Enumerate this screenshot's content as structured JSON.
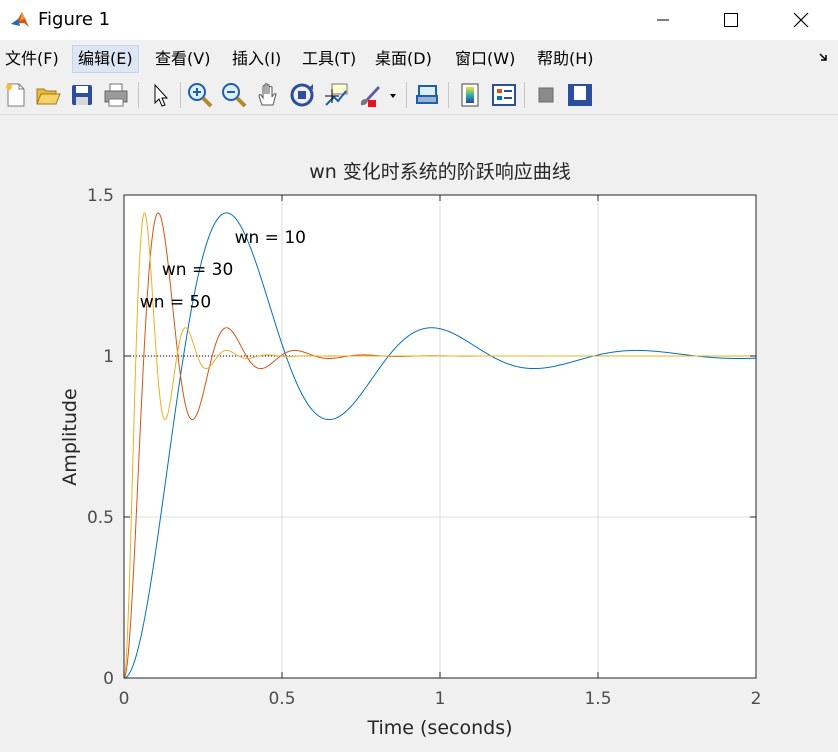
{
  "window": {
    "title": "Figure 1"
  },
  "menu": [
    {
      "label": "文件(F)",
      "active": false
    },
    {
      "label": "编辑(E)",
      "active": true
    },
    {
      "label": "查看(V)",
      "active": false
    },
    {
      "label": "插入(I)",
      "active": false
    },
    {
      "label": "工具(T)",
      "active": false
    },
    {
      "label": "桌面(D)",
      "active": false
    },
    {
      "label": "窗口(W)",
      "active": false
    },
    {
      "label": "帮助(H)",
      "active": false
    }
  ],
  "toolbar": {
    "buttons": [
      "new-figure-icon",
      "open-file-icon",
      "save-icon",
      "print-icon",
      "select-arrow-icon",
      "zoom-in-icon",
      "zoom-out-icon",
      "pan-hand-icon",
      "rotate-3d-icon",
      "data-cursor-icon",
      "brush-icon",
      "link-plot-icon",
      "insert-colorbar-icon",
      "insert-legend-icon",
      "hide-plot-tools-icon",
      "show-plot-tools-icon"
    ]
  },
  "colors": {
    "series1": "#0072BD",
    "series2": "#D95319",
    "series3": "#EDB120",
    "grid": "#dcdcdc"
  },
  "chart_data": {
    "type": "line",
    "title": "wn 变化时系统的阶跃响应曲线",
    "xlabel": "Time (seconds)",
    "ylabel": "Amplitude",
    "xlim": [
      0,
      2
    ],
    "ylim": [
      0,
      1.5
    ],
    "xticks": [
      "0",
      "0.5",
      "1",
      "1.5",
      "2"
    ],
    "yticks": [
      "0",
      "0.5",
      "1",
      "1.5"
    ],
    "grid": true,
    "damping_ratio": 0.25,
    "reference_line": 1,
    "series": [
      {
        "name": "wn = 10",
        "wn": 10,
        "color": "#0072BD"
      },
      {
        "name": "wn = 30",
        "wn": 30,
        "color": "#D95319"
      },
      {
        "name": "wn = 50",
        "wn": 50,
        "color": "#EDB120"
      }
    ],
    "annotations": [
      {
        "text": "wn = 10",
        "x": 0.35,
        "y": 1.37
      },
      {
        "text": "wn = 30",
        "x": 0.12,
        "y": 1.27
      },
      {
        "text": "wn = 50",
        "x": 0.05,
        "y": 1.17
      }
    ]
  }
}
